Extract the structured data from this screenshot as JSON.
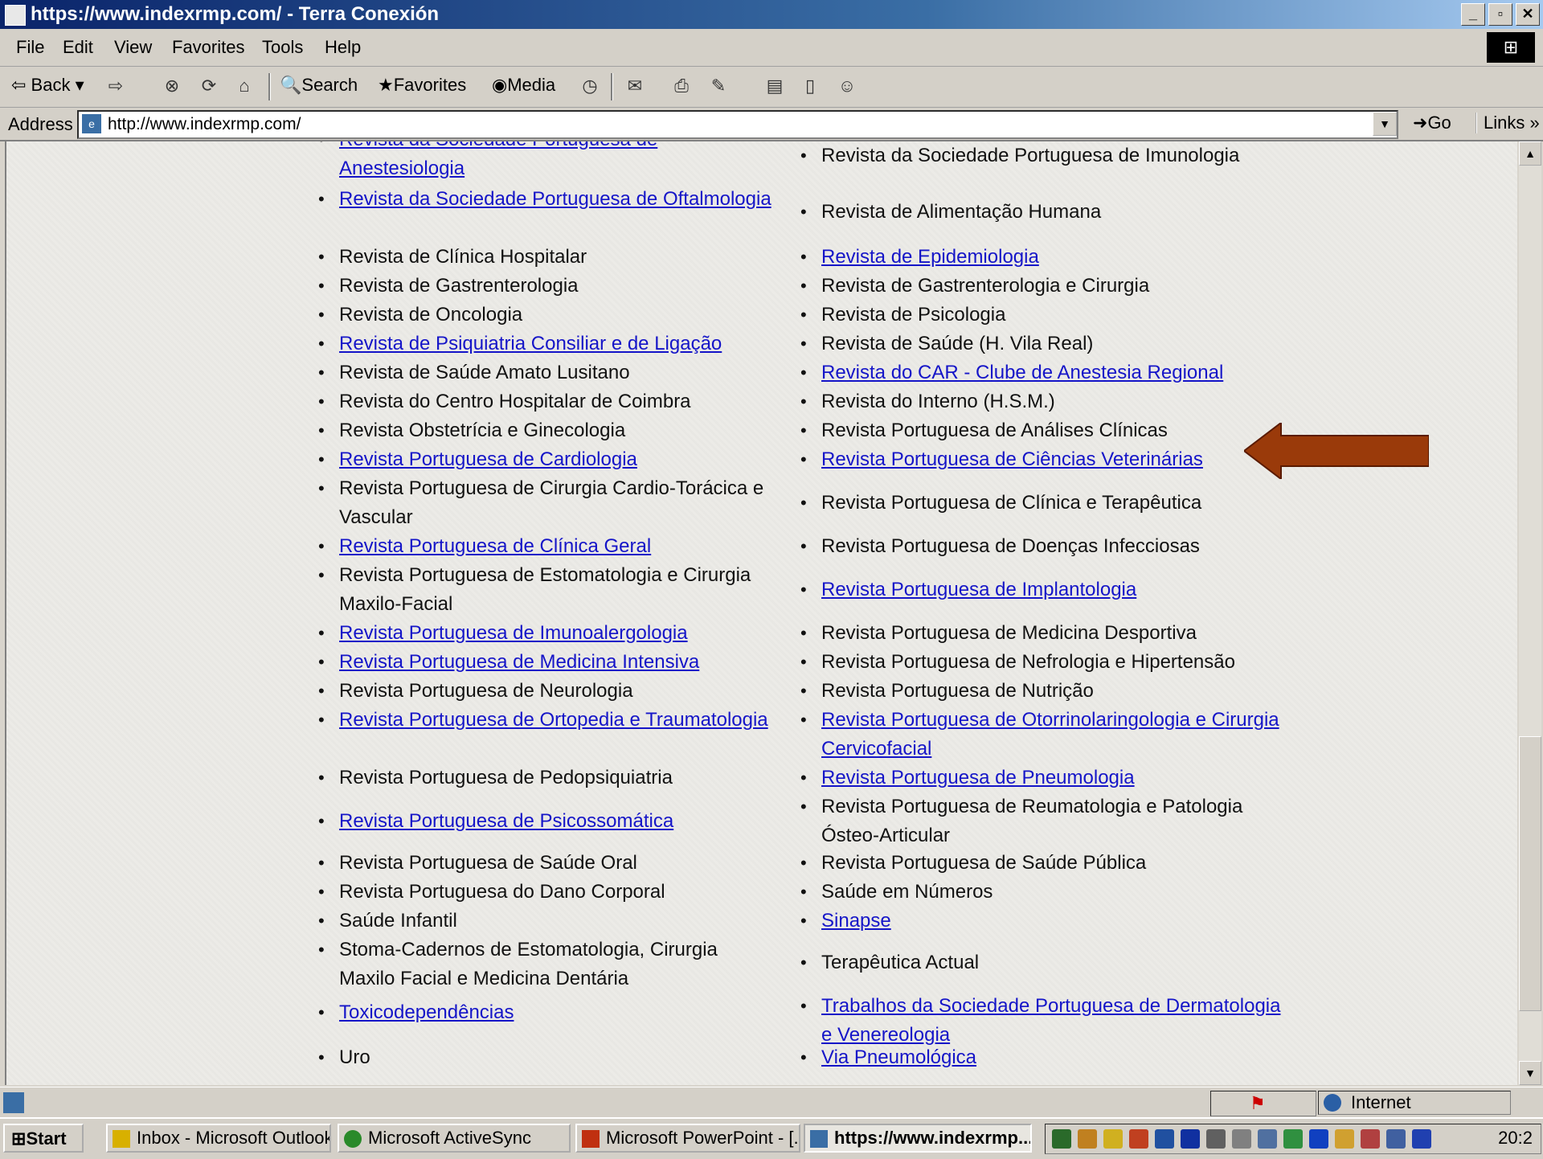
{
  "window": {
    "title": "https://www.indexrmp.com/ - Terra Conexión",
    "buttons": [
      "_",
      "▫",
      "✕"
    ]
  },
  "menu": {
    "items": [
      "File",
      "Edit",
      "View",
      "Favorites",
      "Tools",
      "Help"
    ]
  },
  "toolbar": {
    "back": "Back",
    "search": "Search",
    "favorites": "Favorites",
    "media": "Media"
  },
  "address": {
    "label": "Address",
    "url": "http://www.indexrmp.com/",
    "go": "Go",
    "links": "Links »"
  },
  "content": {
    "left_column": [
      {
        "text": "Revista da Sociedade Portuguesa de Anestesiologia",
        "link": true
      },
      {
        "text": "Revista da Sociedade Portuguesa de Oftalmologia",
        "link": true
      },
      {
        "text": "Revista de Clínica Hospitalar",
        "link": false
      },
      {
        "text": "Revista de Gastrenterologia",
        "link": false
      },
      {
        "text": "Revista de Oncologia",
        "link": false
      },
      {
        "text": "Revista de Psiquiatria Consiliar e de Ligação",
        "link": true
      },
      {
        "text": "Revista de Saúde Amato Lusitano",
        "link": false
      },
      {
        "text": "Revista do Centro Hospitalar de Coimbra",
        "link": false
      },
      {
        "text": "Revista Obstetrícia e Ginecologia",
        "link": false
      },
      {
        "text": "Revista Portuguesa de Cardiologia",
        "link": true
      },
      {
        "text": "Revista Portuguesa de Cirurgia Cardio-Torácica e Vascular",
        "link": false
      },
      {
        "text": "Revista Portuguesa de Clínica Geral",
        "link": true
      },
      {
        "text": "Revista Portuguesa de Estomatologia e Cirurgia Maxilo-Facial",
        "link": false
      },
      {
        "text": "Revista Portuguesa de Imunoalergologia",
        "link": true
      },
      {
        "text": "Revista Portuguesa de Medicina Intensiva",
        "link": true
      },
      {
        "text": "Revista Portuguesa de Neurologia",
        "link": false
      },
      {
        "text": "Revista Portuguesa de Ortopedia e Traumatologia",
        "link": true
      },
      {
        "text": "Revista Portuguesa de Pedopsiquiatria",
        "link": false
      },
      {
        "text": "Revista Portuguesa de Psicossomática",
        "link": true
      },
      {
        "text": "Revista Portuguesa de Saúde Oral",
        "link": false
      },
      {
        "text": "Revista Portuguesa do Dano Corporal",
        "link": false
      },
      {
        "text": "Saúde Infantil",
        "link": false
      },
      {
        "text": "Stoma-Cadernos de Estomatologia, Cirurgia Maxilo Facial e Medicina Dentária",
        "link": false
      },
      {
        "text": "Toxicodependências",
        "link": true
      },
      {
        "text": "Uro",
        "link": false
      }
    ],
    "right_column": [
      {
        "text": "Revista da Sociedade Portuguesa de Imunologia",
        "link": false
      },
      {
        "text": "Revista de Alimentação Humana",
        "link": false
      },
      {
        "text": "Revista de Epidemiologia",
        "link": true
      },
      {
        "text": "Revista de Gastrenterologia e Cirurgia",
        "link": false
      },
      {
        "text": "Revista de Psicologia",
        "link": false
      },
      {
        "text": "Revista de Saúde (H. Vila Real)",
        "link": false
      },
      {
        "text": "Revista do CAR - Clube de Anestesia Regional",
        "link": true
      },
      {
        "text": "Revista do Interno (H.S.M.)",
        "link": false
      },
      {
        "text": "Revista Portuguesa de Análises Clínicas",
        "link": false
      },
      {
        "text": "Revista Portuguesa de Ciências Veterinárias",
        "link": true
      },
      {
        "text": "Revista Portuguesa de Clínica e Terapêutica",
        "link": false
      },
      {
        "text": "Revista Portuguesa de Doenças Infecciosas",
        "link": false
      },
      {
        "text": "Revista Portuguesa de Implantologia",
        "link": true
      },
      {
        "text": "Revista Portuguesa de Medicina Desportiva",
        "link": false
      },
      {
        "text": "Revista Portuguesa de Nefrologia e Hipertensão",
        "link": false
      },
      {
        "text": "Revista Portuguesa de Nutrição",
        "link": false
      },
      {
        "text": "Revista Portuguesa de Otorrinolaringologia e Cirurgia Cervicofacial",
        "link": true
      },
      {
        "text": "Revista Portuguesa de Pneumologia",
        "link": true
      },
      {
        "text": "Revista Portuguesa de Reumatologia e Patologia Ósteo-Articular",
        "link": false
      },
      {
        "text": "Revista Portuguesa de Saúde Pública",
        "link": false
      },
      {
        "text": "Saúde em Números",
        "link": false
      },
      {
        "text": "Sinapse",
        "link": true
      },
      {
        "text": "Terapêutica Actual",
        "link": false
      },
      {
        "text": "Trabalhos da Sociedade Portuguesa de Dermatologia e Venereologia",
        "link": true
      },
      {
        "text": "Via Pneumológica",
        "link": true
      }
    ]
  },
  "status": {
    "zone": "Internet"
  },
  "taskbar": {
    "start": "Start",
    "tasks": [
      "Inbox - Microsoft Outlook",
      "Microsoft ActiveSync",
      "Microsoft PowerPoint - [...]",
      "https://www.indexrmp..."
    ],
    "clock": "20:2"
  },
  "colors": {
    "link": "#1515c8",
    "arrow": "#9a3a0a"
  }
}
